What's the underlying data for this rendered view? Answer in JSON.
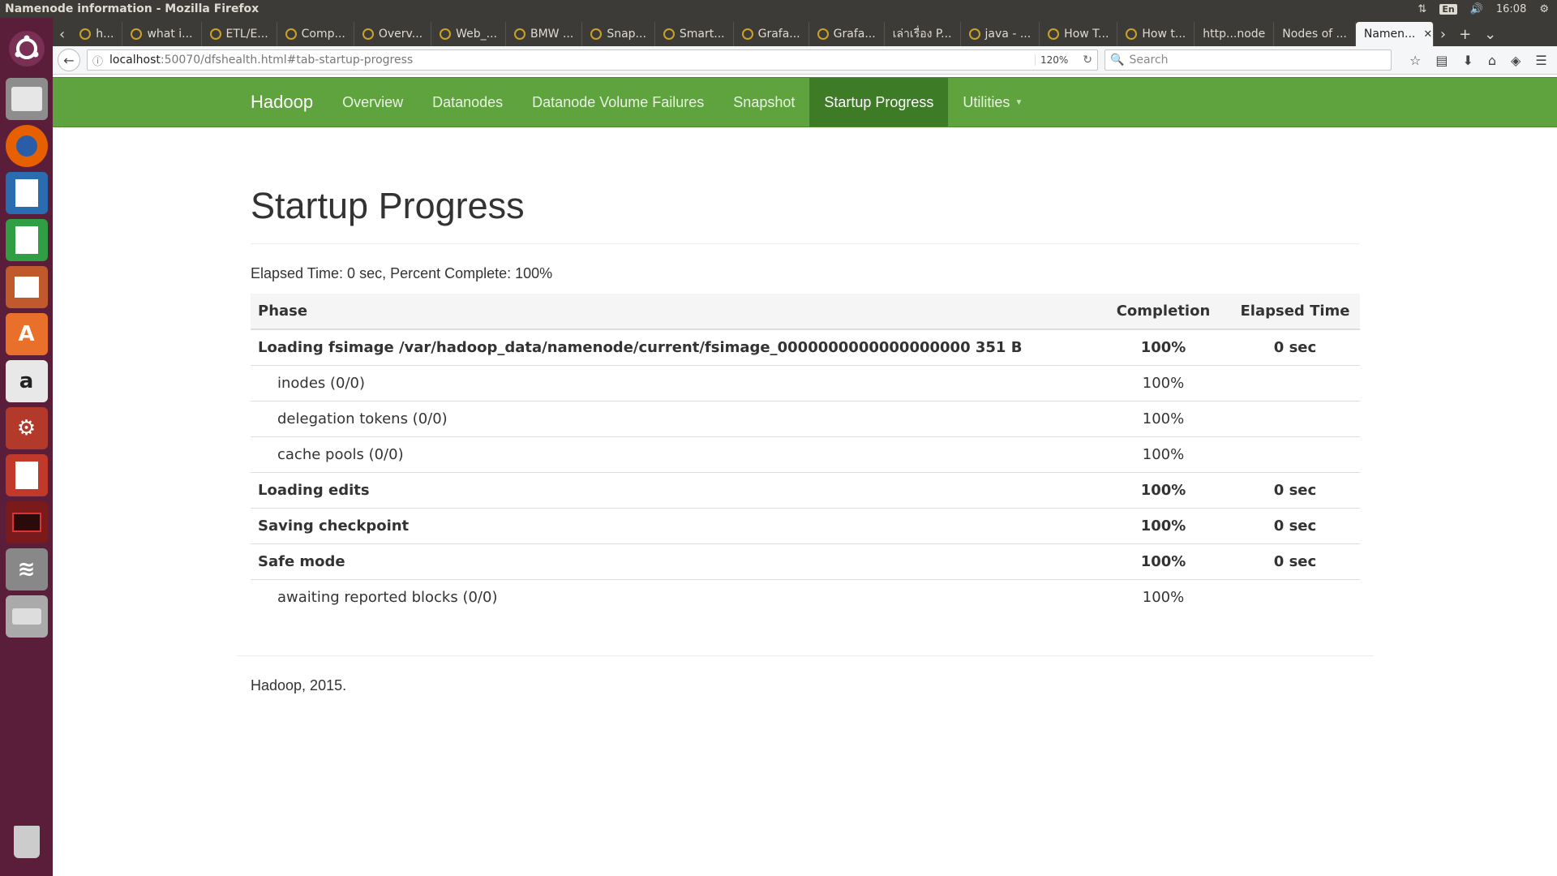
{
  "system_bar": {
    "window_title": "Namenode information - Mozilla Firefox",
    "lang": "En",
    "time": "16:08"
  },
  "launcher": {
    "icons": [
      "ubuntu-icon",
      "files-icon",
      "firefox-icon",
      "writer-icon",
      "calc-icon",
      "impress-icon",
      "software-center-icon",
      "amazon-icon",
      "settings-icon",
      "pdf-viewer-icon",
      "terminal-icon",
      "network-icon",
      "drive-icon",
      "trash-icon"
    ]
  },
  "tabs": [
    {
      "label": "h..."
    },
    {
      "label": "what i..."
    },
    {
      "label": "ETL/E..."
    },
    {
      "label": "Comp..."
    },
    {
      "label": "Overv..."
    },
    {
      "label": "Web_..."
    },
    {
      "label": "BMW ..."
    },
    {
      "label": "Snap..."
    },
    {
      "label": "Smart..."
    },
    {
      "label": "Grafa..."
    },
    {
      "label": "Grafa..."
    },
    {
      "label": "เล่าเรื่อง P..."
    },
    {
      "label": "java - ..."
    },
    {
      "label": "How T..."
    },
    {
      "label": "How t..."
    },
    {
      "label": "http...node"
    },
    {
      "label": "Nodes of ..."
    }
  ],
  "active_tab": {
    "label": "Namen..."
  },
  "address_bar": {
    "host": "localhost",
    "path": ":50070/dfshealth.html#tab-startup-progress",
    "zoom": "120%"
  },
  "search": {
    "placeholder": "Search"
  },
  "hadoop_nav": {
    "brand": "Hadoop",
    "items": [
      "Overview",
      "Datanodes",
      "Datanode Volume Failures",
      "Snapshot",
      "Startup Progress",
      "Utilities"
    ]
  },
  "page": {
    "title": "Startup Progress",
    "summary": "Elapsed Time: 0 sec, Percent Complete: 100%",
    "table": {
      "headers": {
        "phase": "Phase",
        "completion": "Completion",
        "elapsed": "Elapsed Time"
      },
      "rows": [
        {
          "name": "Loading fsimage /var/hadoop_data/namenode/current/fsimage_0000000000000000000 351 B",
          "completion": "100%",
          "elapsed": "0 sec"
        },
        {
          "name": "inodes (0/0)",
          "completion": "100%",
          "elapsed": ""
        },
        {
          "name": "delegation tokens (0/0)",
          "completion": "100%",
          "elapsed": ""
        },
        {
          "name": "cache pools (0/0)",
          "completion": "100%",
          "elapsed": ""
        },
        {
          "name": "Loading edits",
          "completion": "100%",
          "elapsed": "0 sec"
        },
        {
          "name": "Saving checkpoint",
          "completion": "100%",
          "elapsed": "0 sec"
        },
        {
          "name": "Safe mode",
          "completion": "100%",
          "elapsed": "0 sec"
        },
        {
          "name": "awaiting reported blocks (0/0)",
          "completion": "100%",
          "elapsed": ""
        }
      ]
    },
    "footer": "Hadoop, 2015."
  },
  "colors": {
    "hadoop_green": "#5fa33e",
    "hadoop_green_active": "#3e7b27",
    "launcher_bg": "#5b1e3a",
    "topbar_bg": "#3c3b37"
  }
}
